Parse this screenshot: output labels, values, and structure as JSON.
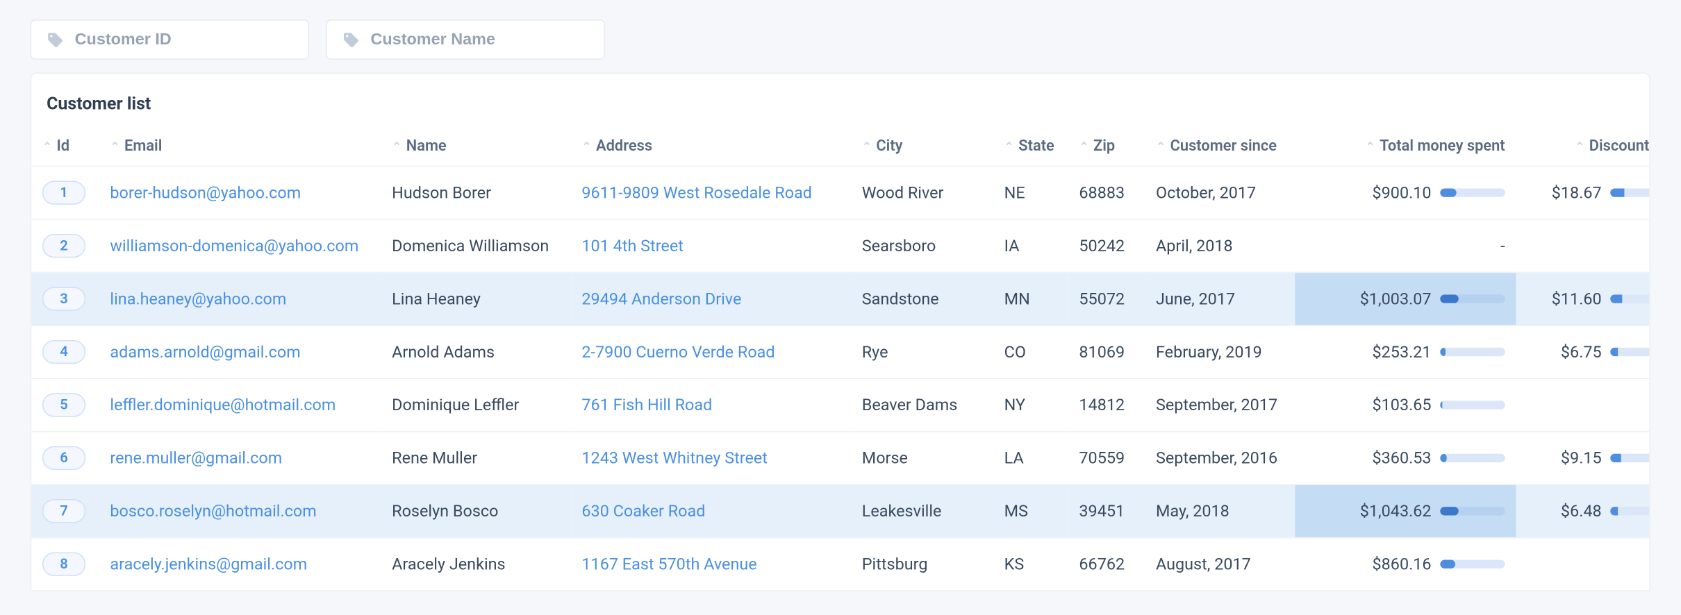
{
  "filters": {
    "customer_id_placeholder": "Customer ID",
    "customer_name_placeholder": "Customer Name"
  },
  "card": {
    "title": "Customer list"
  },
  "columns": {
    "id": "Id",
    "email": "Email",
    "name": "Name",
    "address": "Address",
    "city": "City",
    "state": "State",
    "zip": "Zip",
    "customer_since": "Customer since",
    "total_spent": "Total money spent",
    "discount": "Discount"
  },
  "rows": [
    {
      "id": "1",
      "email": "borer-hudson@yahoo.com",
      "name": "Hudson Borer",
      "address": "9611-9809 West Rosedale Road",
      "city": "Wood River",
      "state": "NE",
      "zip": "68883",
      "since": "October, 2017",
      "spent": "$900.10",
      "spent_pct": 25,
      "discount": "$18.67",
      "discount_pct": 35,
      "row_highlight": false,
      "spent_cell_highlight": false,
      "discount_cell_highlight": false
    },
    {
      "id": "2",
      "email": "williamson-domenica@yahoo.com",
      "name": "Domenica Williamson",
      "address": "101 4th Street",
      "city": "Searsboro",
      "state": "IA",
      "zip": "50242",
      "since": "April, 2018",
      "spent": "-",
      "spent_pct": null,
      "discount": "",
      "discount_pct": null,
      "row_highlight": false,
      "spent_cell_highlight": false,
      "discount_cell_highlight": false
    },
    {
      "id": "3",
      "email": "lina.heaney@yahoo.com",
      "name": "Lina Heaney",
      "address": "29494 Anderson Drive",
      "city": "Sandstone",
      "state": "MN",
      "zip": "55072",
      "since": "June, 2017",
      "spent": "$1,003.07",
      "spent_pct": 28,
      "discount": "$11.60",
      "discount_pct": 30,
      "row_highlight": true,
      "spent_cell_highlight": true,
      "discount_cell_highlight": false
    },
    {
      "id": "4",
      "email": "adams.arnold@gmail.com",
      "name": "Arnold Adams",
      "address": "2-7900 Cuerno Verde Road",
      "city": "Rye",
      "state": "CO",
      "zip": "81069",
      "since": "February, 2019",
      "spent": "$253.21",
      "spent_pct": 8,
      "discount": "$6.75",
      "discount_pct": 20,
      "row_highlight": false,
      "spent_cell_highlight": false,
      "discount_cell_highlight": false
    },
    {
      "id": "5",
      "email": "leffler.dominique@hotmail.com",
      "name": "Dominique Leffler",
      "address": "761 Fish Hill Road",
      "city": "Beaver Dams",
      "state": "NY",
      "zip": "14812",
      "since": "September, 2017",
      "spent": "$103.65",
      "spent_pct": 4,
      "discount": "",
      "discount_pct": null,
      "row_highlight": false,
      "spent_cell_highlight": false,
      "discount_cell_highlight": false
    },
    {
      "id": "6",
      "email": "rene.muller@gmail.com",
      "name": "Rene Muller",
      "address": "1243 West Whitney Street",
      "city": "Morse",
      "state": "LA",
      "zip": "70559",
      "since": "September, 2016",
      "spent": "$360.53",
      "spent_pct": 11,
      "discount": "$9.15",
      "discount_pct": 28,
      "row_highlight": false,
      "spent_cell_highlight": false,
      "discount_cell_highlight": false
    },
    {
      "id": "7",
      "email": "bosco.roselyn@hotmail.com",
      "name": "Roselyn Bosco",
      "address": "630 Coaker Road",
      "city": "Leakesville",
      "state": "MS",
      "zip": "39451",
      "since": "May, 2018",
      "spent": "$1,043.62",
      "spent_pct": 29,
      "discount": "$6.48",
      "discount_pct": 20,
      "row_highlight": true,
      "spent_cell_highlight": true,
      "discount_cell_highlight": false
    },
    {
      "id": "8",
      "email": "aracely.jenkins@gmail.com",
      "name": "Aracely Jenkins",
      "address": "1167 East 570th Avenue",
      "city": "Pittsburg",
      "state": "KS",
      "zip": "66762",
      "since": "August, 2017",
      "spent": "$860.16",
      "spent_pct": 24,
      "discount": "",
      "discount_pct": null,
      "row_highlight": false,
      "spent_cell_highlight": false,
      "discount_cell_highlight": false
    }
  ]
}
